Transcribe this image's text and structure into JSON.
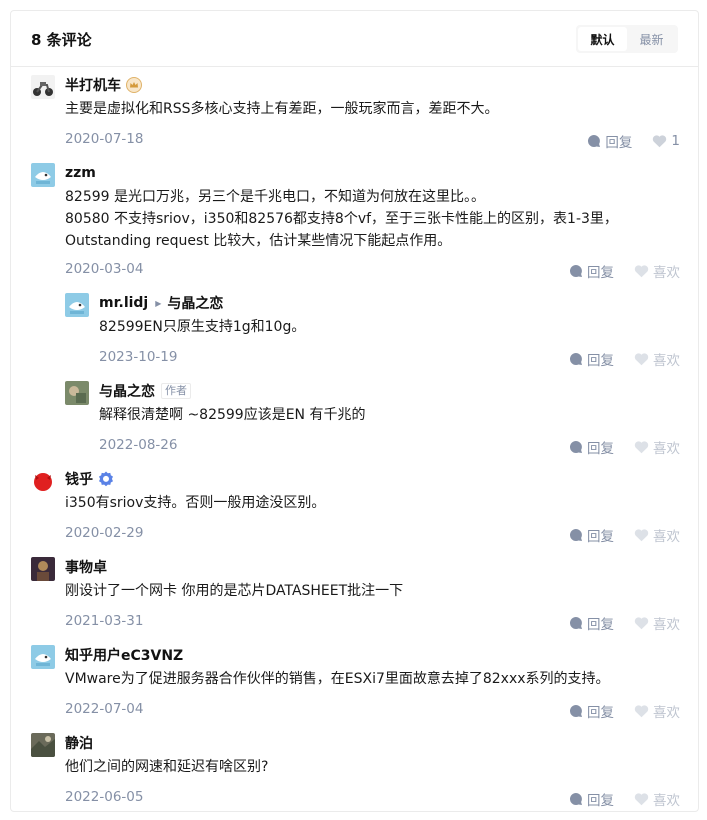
{
  "header": {
    "count_label": "8 条评论",
    "sort": {
      "default": "默认",
      "latest": "最新",
      "active": "default"
    }
  },
  "reply_label": "回复",
  "like_label": "喜欢",
  "comments": [
    {
      "author": "半打机车",
      "lines": [
        "主要是虚拟化和RSS多核心支持上有差距，一般玩家而言，差距不大。"
      ],
      "date": "2020-07-18",
      "likes": "1",
      "medal": "crown"
    },
    {
      "author": "zzm",
      "lines": [
        "82599 是光口万兆，另三个是千兆电口，不知道为何放在这里比。。",
        "80580 不支持sriov，i350和82576都支持8个vf，至于三张卡性能上的区别，表1-3里，",
        "Outstanding request 比较大，估计某些情况下能起点作用。"
      ],
      "date": "2020-03-04"
    },
    {
      "author": "mr.lidj",
      "reply_to": "与晶之恋",
      "lines": [
        "82599EN只原生支持1g和10g。"
      ],
      "date": "2023-10-19"
    },
    {
      "author": "与晶之恋",
      "tag": "作者",
      "lines": [
        "解释很清楚啊 ~82599应该是EN 有千兆的"
      ],
      "date": "2022-08-26"
    },
    {
      "author": "钱乎",
      "lines": [
        "i350有sriov支持。否则一般用途没区别。"
      ],
      "date": "2020-02-29",
      "medal": "verified"
    },
    {
      "author": "事物卓",
      "lines": [
        "刚设计了一个网卡 你用的是芯片DATASHEET批注一下"
      ],
      "date": "2021-03-31"
    },
    {
      "author": "知乎用户eC3VNZ",
      "lines": [
        "VMware为了促进服务器合作伙伴的销售，在ESXi7里面故意去掉了82xxx系列的支持。"
      ],
      "date": "2022-07-04"
    },
    {
      "author": "静泊",
      "lines": [
        "他们之间的网速和延迟有啥区别?"
      ],
      "date": "2022-06-05"
    }
  ]
}
